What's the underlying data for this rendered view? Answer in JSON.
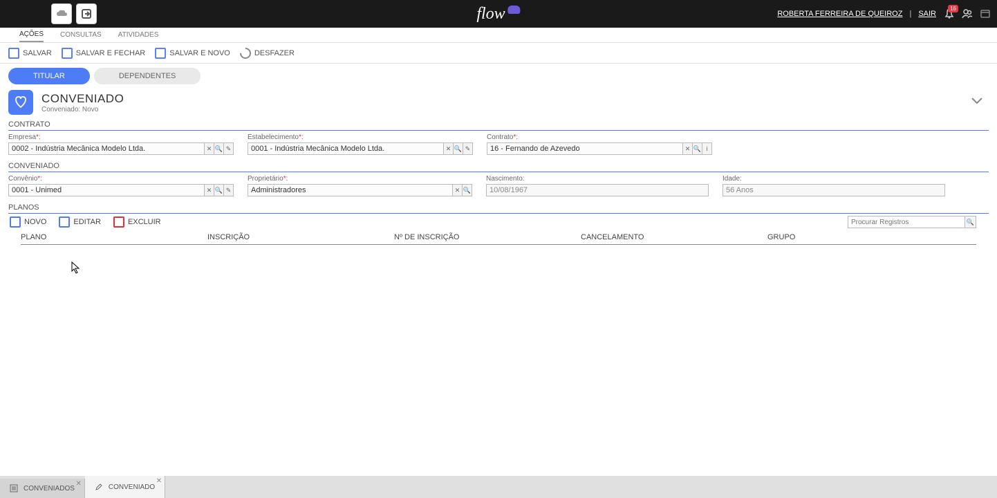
{
  "topbar": {
    "user_name": "ROBERTA FERREIRA DE QUEIROZ",
    "sep": " | ",
    "logout": "SAIR",
    "notif_count": "16",
    "logo_text": "flow"
  },
  "menutabs": {
    "acoes": "AÇÕES",
    "consultas": "CONSULTAS",
    "atividades": "ATIVIDADES"
  },
  "toolbar": {
    "salvar": "SALVAR",
    "salvar_fechar": "SALVAR E FECHAR",
    "salvar_novo": "SALVAR E NOVO",
    "desfazer": "DESFAZER"
  },
  "subtabs": {
    "titular": "TITULAR",
    "dependentes": "DEPENDENTES"
  },
  "page": {
    "title": "CONVENIADO",
    "sub": "Conveniado: Novo"
  },
  "contrato": {
    "section": "CONTRATO",
    "empresa_label": "Empresa",
    "empresa_value": "0002 - Indústria Mecânica Modelo Ltda.",
    "estab_label": "Estabelecimento",
    "estab_value": "0001 - Indústria Mecânica Modelo Ltda.",
    "contrato_label": "Contrato",
    "contrato_value": "16 - Fernando de Azevedo"
  },
  "conveniado": {
    "section": "CONVENIADO",
    "convenio_label": "Convênio",
    "convenio_value": "0001 - Unimed",
    "propr_label": "Proprietário",
    "propr_value": "Administradores",
    "nasc_label": "Nascimento:",
    "nasc_value": "10/08/1967",
    "idade_label": "Idade:",
    "idade_value": "56 Anos"
  },
  "planos": {
    "section": "PLANOS",
    "novo": "NOVO",
    "editar": "EDITAR",
    "excluir": "EXCLUIR",
    "search_placeholder": "Procurar Registros",
    "col_plano": "PLANO",
    "col_inscricao": "INSCRIÇÃO",
    "col_num": "Nº DE INSCRIÇÃO",
    "col_canc": "CANCELAMENTO",
    "col_grupo": "GRUPO"
  },
  "bottom": {
    "conveniados": "CONVENIADOS",
    "conveniado": "CONVENIADO"
  },
  "req_star": "*:"
}
